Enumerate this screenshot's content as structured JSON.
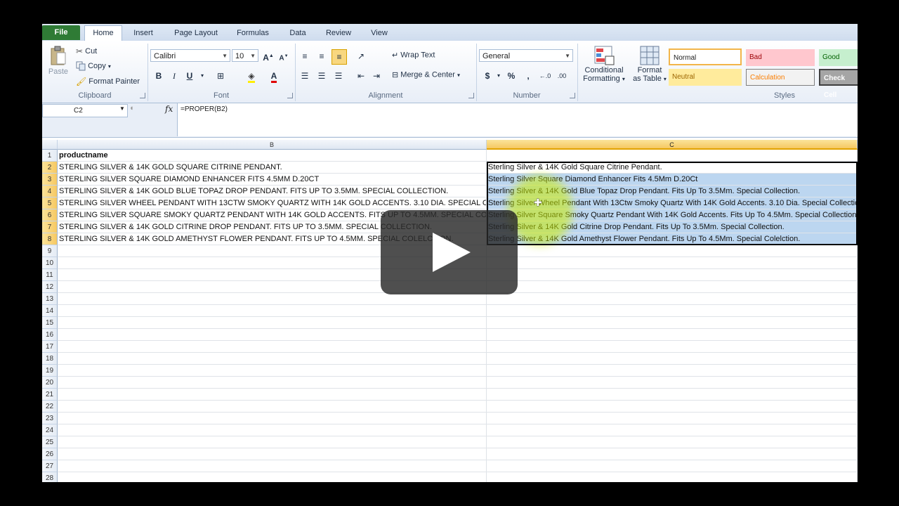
{
  "tabs": [
    "File",
    "Home",
    "Insert",
    "Page Layout",
    "Formulas",
    "Data",
    "Review",
    "View"
  ],
  "clipboard": {
    "paste": "Paste",
    "cut": "Cut",
    "copy": "Copy",
    "format_painter": "Format Painter",
    "label": "Clipboard"
  },
  "font": {
    "name": "Calibri",
    "size": "10",
    "label": "Font"
  },
  "alignment": {
    "wrap": "Wrap Text",
    "merge": "Merge & Center",
    "label": "Alignment"
  },
  "number": {
    "format": "General",
    "label": "Number"
  },
  "styles": {
    "conditional": "Conditional Formatting",
    "conditional_line1": "Conditional",
    "conditional_line2": "Formatting",
    "format_table_line1": "Format",
    "format_table_line2": "as Table",
    "normal": "Normal",
    "bad": "Bad",
    "good": "Good",
    "neutral": "Neutral",
    "calculation": "Calculation",
    "check_cell": "Check Cell",
    "label": "Styles"
  },
  "formula_bar": {
    "name_box": "C2",
    "formula": "=PROPER(B2)"
  },
  "columns": [
    "B",
    "C"
  ],
  "rows": [
    {
      "num": "1",
      "b": "productname",
      "c": ""
    },
    {
      "num": "2",
      "b": "STERLING SILVER & 14K GOLD SQUARE CITRINE PENDANT.",
      "c": "Sterling Silver & 14K Gold Square Citrine Pendant."
    },
    {
      "num": "3",
      "b": "STERLING SILVER SQUARE DIAMOND ENHANCER FITS 4.5MM D.20CT",
      "c": "Sterling Silver Square Diamond Enhancer Fits 4.5Mm D.20Ct"
    },
    {
      "num": "4",
      "b": "STERLING SILVER & 14K GOLD BLUE TOPAZ DROP PENDANT.  FITS UP TO 3.5MM. SPECIAL COLLECTION.",
      "c": "Sterling Silver & 14K Gold Blue Topaz Drop Pendant.  Fits Up To 3.5Mm. Special Collection."
    },
    {
      "num": "5",
      "b": "STERLING SILVER WHEEL PENDANT WITH 13CTW SMOKY QUARTZ WITH 14K GOLD ACCENTS. 3.10 DIA. SPECIAL COLLECTION.",
      "c": "Sterling Silver Wheel Pendant With 13Ctw Smoky Quartz With 14K Gold Accents. 3.10 Dia. Special Collection."
    },
    {
      "num": "6",
      "b": "STERLING SILVER SQUARE SMOKY QUARTZ PENDANT WITH 14K GOLD ACCENTS. FITS UP TO 4.5MM. SPECIAL COLLECTION.",
      "c": "Sterling Silver Square Smoky Quartz Pendant With 14K Gold Accents. Fits Up To 4.5Mm. Special Collection."
    },
    {
      "num": "7",
      "b": "STERLING SILVER & 14K GOLD CITRINE DROP PENDANT.  FITS UP TO 3.5MM. SPECIAL COLLECTION.",
      "c": "Sterling Silver & 14K Gold Citrine Drop Pendant.  Fits Up To 3.5Mm. Special Collection."
    },
    {
      "num": "8",
      "b": "STERLING SILVER & 14K GOLD AMETHYST FLOWER  PENDANT. FITS UP TO 4.5MM. SPECIAL COLELCTION.",
      "c": "Sterling Silver & 14K Gold Amethyst Flower  Pendant. Fits Up To 4.5Mm. Special Colelction."
    },
    {
      "num": "9",
      "b": "",
      "c": ""
    },
    {
      "num": "10",
      "b": "",
      "c": ""
    },
    {
      "num": "11",
      "b": "",
      "c": ""
    },
    {
      "num": "12",
      "b": "",
      "c": ""
    },
    {
      "num": "13",
      "b": "",
      "c": ""
    },
    {
      "num": "14",
      "b": "",
      "c": ""
    },
    {
      "num": "15",
      "b": "",
      "c": ""
    },
    {
      "num": "16",
      "b": "",
      "c": ""
    },
    {
      "num": "17",
      "b": "",
      "c": ""
    },
    {
      "num": "18",
      "b": "",
      "c": ""
    },
    {
      "num": "19",
      "b": "",
      "c": ""
    },
    {
      "num": "20",
      "b": "",
      "c": ""
    },
    {
      "num": "21",
      "b": "",
      "c": ""
    },
    {
      "num": "22",
      "b": "",
      "c": ""
    },
    {
      "num": "23",
      "b": "",
      "c": ""
    },
    {
      "num": "24",
      "b": "",
      "c": ""
    },
    {
      "num": "25",
      "b": "",
      "c": ""
    },
    {
      "num": "26",
      "b": "",
      "c": ""
    },
    {
      "num": "27",
      "b": "",
      "c": ""
    },
    {
      "num": "28",
      "b": "",
      "c": ""
    }
  ],
  "colors": {
    "file_tab": "#2f7b35",
    "selection": "#bcd6f0",
    "header_selected": "#f6c862"
  }
}
